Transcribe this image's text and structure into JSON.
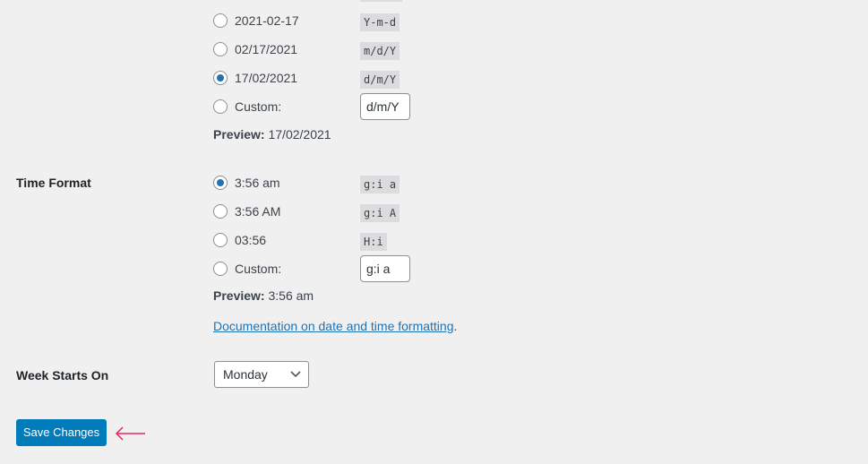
{
  "date_format": {
    "options": [
      {
        "label": "2021-02-17",
        "code": "Y-m-d",
        "checked": false
      },
      {
        "label": "02/17/2021",
        "code": "m/d/Y",
        "checked": false
      },
      {
        "label": "17/02/2021",
        "code": "d/m/Y",
        "checked": true
      }
    ],
    "custom_label": "Custom:",
    "custom_value": "d/m/Y",
    "preview_label": "Preview:",
    "preview_value": "17/02/2021"
  },
  "time_format": {
    "title": "Time Format",
    "options": [
      {
        "label": "3:56 am",
        "code": "g:i a",
        "checked": true
      },
      {
        "label": "3:56 AM",
        "code": "g:i A",
        "checked": false
      },
      {
        "label": "03:56",
        "code": "H:i",
        "checked": false
      }
    ],
    "custom_label": "Custom:",
    "custom_value": "g:i a",
    "preview_label": "Preview:",
    "preview_value": "3:56 am"
  },
  "doc_link": "Documentation on date and time formatting",
  "doc_period": ".",
  "week": {
    "title": "Week Starts On",
    "selected": "Monday"
  },
  "save_label": "Save Changes",
  "colors": {
    "accent": "#2271b1",
    "button": "#007cba",
    "arrow": "#e8275a"
  }
}
